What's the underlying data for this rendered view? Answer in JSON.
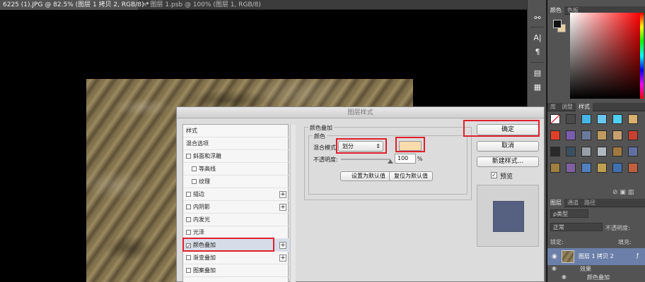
{
  "tabs": [
    {
      "label": "6225 (1).JPG @ 82.5% (图层 1 拷贝 2, RGB/8) *",
      "close": "×"
    },
    {
      "label": "图层 1.psb @ 100% (图层 1, RGB/8)",
      "close": "×"
    }
  ],
  "tools": {
    "items": [
      "⚯",
      "A|",
      "¶",
      "▤",
      "▦"
    ]
  },
  "color_panel": {
    "tabs": [
      "颜色",
      "色板"
    ],
    "foreground": "#111111",
    "background": "#e8d0a0"
  },
  "styles_panel": {
    "tabs": [
      "库",
      "调整",
      "样式"
    ],
    "swatch_colors": [
      "#ffffff",
      "#4a4a4a",
      "#46b6e6",
      "#6ac8ee",
      "#4ed0f0",
      "#d8b070",
      "#e0402a",
      "#7a5cb0",
      "#6a7a9a",
      "#c09a60",
      "#c8a070",
      "#c84030",
      "#2a2a2a",
      "#3a5060",
      "#9aa0a8",
      "#b0b8c0",
      "#a07840",
      "#6070a0",
      "#a08040",
      "#8060a0",
      "#5080c0",
      "#c0a050",
      "#4070b0",
      "#c06040"
    ]
  },
  "layers_panel": {
    "tabs": [
      "图层",
      "通道",
      "路径"
    ],
    "filter_label": "ρ类型",
    "blend_mode": "正常",
    "opacity_label": "不透明度:",
    "lock_label": "锁定:",
    "fill_label": "填充:",
    "layer_name": "图层 1 拷贝 2",
    "effects_label": "效果",
    "effect_item": "颜色叠加"
  },
  "dialog": {
    "title": "图层样式",
    "style_list": [
      {
        "label": "样式",
        "checkbox": false,
        "indent": 0,
        "plus": false
      },
      {
        "label": "混合选项",
        "checkbox": false,
        "indent": 0,
        "plus": false
      },
      {
        "label": "斜面和浮雕",
        "checkbox": true,
        "checked": false,
        "indent": 0,
        "plus": false
      },
      {
        "label": "等高线",
        "checkbox": true,
        "checked": false,
        "indent": 1,
        "plus": false
      },
      {
        "label": "纹理",
        "checkbox": true,
        "checked": false,
        "indent": 1,
        "plus": false
      },
      {
        "label": "描边",
        "checkbox": true,
        "checked": false,
        "indent": 0,
        "plus": true
      },
      {
        "label": "内阴影",
        "checkbox": true,
        "checked": false,
        "indent": 0,
        "plus": true
      },
      {
        "label": "内发光",
        "checkbox": true,
        "checked": false,
        "indent": 0,
        "plus": false
      },
      {
        "label": "光泽",
        "checkbox": true,
        "checked": false,
        "indent": 0,
        "plus": false
      },
      {
        "label": "颜色叠加",
        "checkbox": true,
        "checked": true,
        "indent": 0,
        "plus": true
      },
      {
        "label": "渐变叠加",
        "checkbox": true,
        "checked": false,
        "indent": 0,
        "plus": true
      },
      {
        "label": "图案叠加",
        "checkbox": true,
        "checked": false,
        "indent": 0,
        "plus": false
      }
    ],
    "options": {
      "section_title": "颜色叠加",
      "group_title": "颜色",
      "blend_label": "混合模式:",
      "blend_value": "划分",
      "overlay_color": "#f8dcac",
      "opacity_label": "不透明度:",
      "opacity_value": "100",
      "opacity_unit": "%",
      "opacity_fraction": 1.0,
      "reset_default_label": "设置为默认值",
      "restore_default_label": "复位为默认值"
    },
    "ok_label": "确定",
    "cancel_label": "取消",
    "new_style_label": "新建样式...",
    "preview_label": "预览",
    "preview_checked": true,
    "preview_color": "#566080"
  }
}
